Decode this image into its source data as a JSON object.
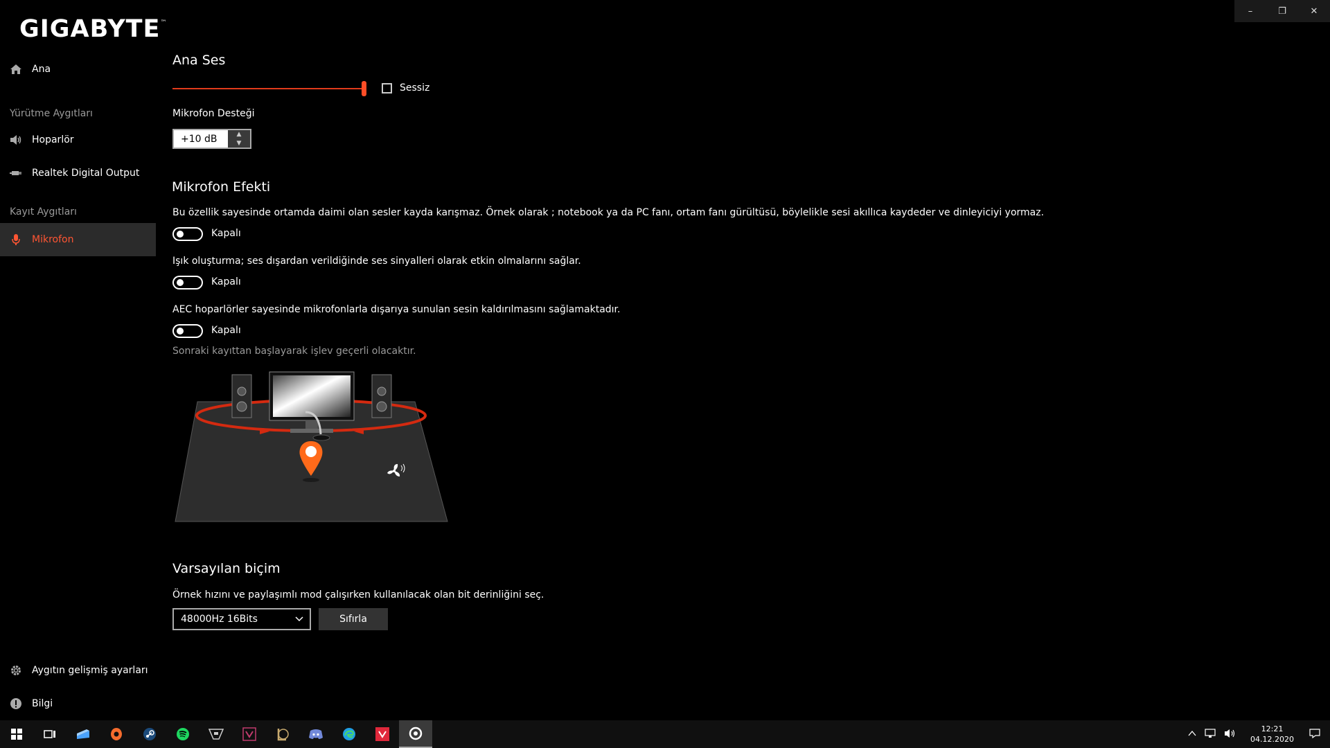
{
  "window": {
    "minimize": "–",
    "maximize": "❐",
    "close": "✕"
  },
  "brand": {
    "logo_text": "GIGABYTE",
    "trademark": "™",
    "accent": "#ff4d26"
  },
  "sidebar": {
    "home": {
      "label": "Ana",
      "icon": "home-icon"
    },
    "playback_group": "Yürütme Aygıtları",
    "playback": [
      {
        "label": "Hoparlör",
        "icon": "speaker-icon"
      },
      {
        "label": "Realtek Digital Output",
        "icon": "digital-output-icon"
      }
    ],
    "record_group": "Kayıt Aygıtları",
    "record": [
      {
        "label": "Mikrofon",
        "icon": "microphone-icon",
        "active": true
      }
    ],
    "advanced": {
      "label": "Aygıtın gelişmiş ayarları",
      "icon": "gear-icon"
    },
    "info": {
      "label": "Bilgi",
      "icon": "info-icon"
    }
  },
  "main_volume": {
    "title": "Ana Ses",
    "level": 1.0,
    "mute_label": "Sessiz",
    "mute_checked": false
  },
  "mic_boost": {
    "label": "Mikrofon Desteği",
    "value": "+10 dB"
  },
  "mic_effect": {
    "title": "Mikrofon Efekti",
    "effects": [
      {
        "description": "Bu özellik sayesinde ortamda daimi olan sesler kayda karışmaz. Örnek olarak ; notebook ya da PC fanı, ortam fanı gürültüsü, böylelikle sesi akıllıca kaydeder ve dinleyiciyi yormaz.",
        "state": "Kapalı"
      },
      {
        "description": "Işık oluşturma; ses dışardan verildiğinde ses sinyalleri olarak etkin olmalarını sağlar.",
        "state": "Kapalı"
      },
      {
        "description": "AEC hoparlörler sayesinde mikrofonlarla dışarıya sunulan sesin kaldırılmasını sağlamaktadır.",
        "state": "Kapalı"
      }
    ],
    "note": "Sonraki kayıttan başlayarak işlev geçerli olacaktır."
  },
  "default_format": {
    "title": "Varsayılan biçim",
    "description": "Örnek hızını ve paylaşımlı mod çalışırken kullanılacak olan bit derinliğini seç.",
    "selected": "48000Hz 16Bits",
    "reset_label": "Sıfırla"
  },
  "taskbar": {
    "apps": [
      "windows-start-icon",
      "task-view-icon",
      "file-explorer-icon",
      "origin-icon",
      "steam-icon",
      "spotify-icon",
      "gta-icon",
      "valorant-icon",
      "league-icon",
      "discord-icon",
      "edge-icon",
      "riot-icon",
      "gigabyte-audio-icon"
    ],
    "time": "12:21",
    "date": "04.12.2020"
  }
}
